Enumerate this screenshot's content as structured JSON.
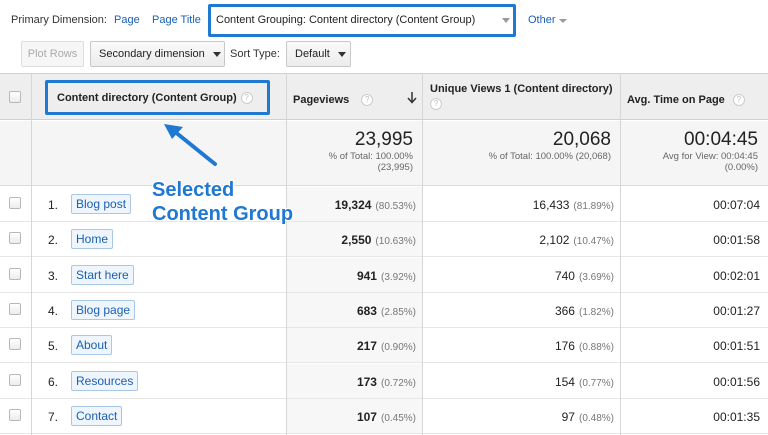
{
  "dimension_bar": {
    "label": "Primary Dimension:",
    "page": "Page",
    "page_title": "Page Title",
    "content_grouping": "Content Grouping: Content directory (Content Group)",
    "other": "Other"
  },
  "toolbar": {
    "plot_rows": "Plot Rows",
    "secondary_dimension": "Secondary dimension",
    "sort_type_label": "Sort Type:",
    "sort_type_value": "Default"
  },
  "table": {
    "headers": {
      "dimension": "Content directory (Content Group)",
      "pageviews": "Pageviews",
      "unique_views": "Unique Views 1 (Content directory)",
      "avg_time": "Avg. Time on Page"
    },
    "totals": {
      "pageviews": "23,995",
      "pageviews_sub1": "% of Total: 100.00%",
      "pageviews_sub2": "(23,995)",
      "unique_views": "20,068",
      "unique_views_sub": "% of Total: 100.00% (20,068)",
      "avg_time": "00:04:45",
      "avg_time_sub1": "Avg for View: 00:04:45",
      "avg_time_sub2": "(0.00%)"
    },
    "rows": [
      {
        "num": "1.",
        "name": "Blog post",
        "pv": "19,324",
        "pv_pct": "(80.53%)",
        "uv": "16,433",
        "uv_pct": "(81.89%)",
        "time": "00:07:04"
      },
      {
        "num": "2.",
        "name": "Home",
        "pv": "2,550",
        "pv_pct": "(10.63%)",
        "uv": "2,102",
        "uv_pct": "(10.47%)",
        "time": "00:01:58"
      },
      {
        "num": "3.",
        "name": "Start here",
        "pv": "941",
        "pv_pct": "(3.92%)",
        "uv": "740",
        "uv_pct": "(3.69%)",
        "time": "00:02:01"
      },
      {
        "num": "4.",
        "name": "Blog page",
        "pv": "683",
        "pv_pct": "(2.85%)",
        "uv": "366",
        "uv_pct": "(1.82%)",
        "time": "00:01:27"
      },
      {
        "num": "5.",
        "name": "About",
        "pv": "217",
        "pv_pct": "(0.90%)",
        "uv": "176",
        "uv_pct": "(0.88%)",
        "time": "00:01:51"
      },
      {
        "num": "6.",
        "name": "Resources",
        "pv": "173",
        "pv_pct": "(0.72%)",
        "uv": "154",
        "uv_pct": "(0.77%)",
        "time": "00:01:56"
      },
      {
        "num": "7.",
        "name": "Contact",
        "pv": "107",
        "pv_pct": "(0.45%)",
        "uv": "97",
        "uv_pct": "(0.48%)",
        "time": "00:01:35"
      }
    ]
  },
  "annotation": {
    "line1": "Selected",
    "line2": "Content Group"
  },
  "colors": {
    "highlight": "#1f78d1",
    "link": "#1a5fb4"
  },
  "icons": [
    "help-icon",
    "sort-down-arrow-icon",
    "chevron-down-icon",
    "checkbox-icon"
  ]
}
